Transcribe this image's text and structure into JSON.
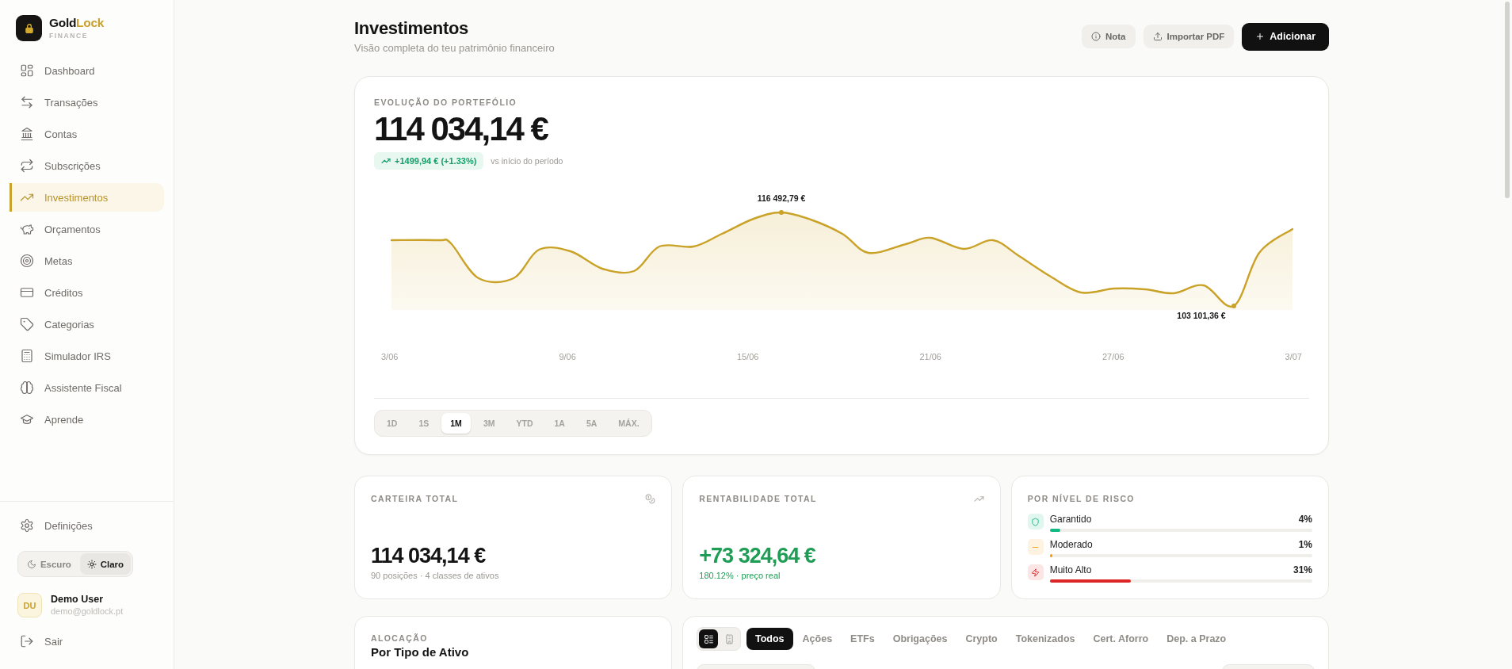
{
  "sidebar": {
    "brand": {
      "name": "Gold",
      "name_accent": "Lock",
      "tagline": "FINANCE"
    },
    "items": [
      {
        "label": "Dashboard",
        "selected": false
      },
      {
        "label": "Transações",
        "selected": false
      },
      {
        "label": "Contas",
        "selected": false
      },
      {
        "label": "Subscrições",
        "selected": false
      },
      {
        "label": "Investimentos",
        "selected": true
      },
      {
        "label": "Orçamentos",
        "selected": false
      },
      {
        "label": "Metas",
        "selected": false
      },
      {
        "label": "Créditos",
        "selected": false
      },
      {
        "label": "Categorias",
        "selected": false
      },
      {
        "label": "Simulador IRS",
        "selected": false
      },
      {
        "label": "Assistente Fiscal",
        "selected": false
      },
      {
        "label": "Aprende",
        "selected": false
      }
    ],
    "settings": {
      "label": "Definições"
    },
    "theme_toggle": [
      {
        "label": "Escuro",
        "selected": false
      },
      {
        "label": "Claro",
        "selected": true
      }
    ],
    "user": {
      "initials": "DU",
      "name": "Demo User",
      "email": "demo@goldlock.pt"
    },
    "logout": {
      "label": "Sair"
    }
  },
  "header": {
    "title": "Investimentos",
    "subtitle": "Visão completa do teu patrimônio financeiro",
    "buttons": [
      {
        "label": "Nota",
        "kind": "ghost"
      },
      {
        "label": "Importar PDF",
        "kind": "ghost"
      },
      {
        "label": "Adicionar",
        "kind": "primary"
      }
    ]
  },
  "portfolio": {
    "label": "EVOLUÇÃO DO PORTEFÓLIO",
    "value": "114 034,14 €",
    "change": "+1499,94 € (+1.33%)",
    "change_note": "vs início do período",
    "peak_label": "116 492,79 €",
    "low_label": "103 101,36 €",
    "x_labels": [
      "3/06",
      "9/06",
      "15/06",
      "21/06",
      "27/06",
      "3/07"
    ],
    "ranges": [
      {
        "label": "1D",
        "selected": false
      },
      {
        "label": "1S",
        "selected": false
      },
      {
        "label": "1M",
        "selected": true
      },
      {
        "label": "3M",
        "selected": false
      },
      {
        "label": "YTD",
        "selected": false
      },
      {
        "label": "1A",
        "selected": false
      },
      {
        "label": "5A",
        "selected": false
      },
      {
        "label": "MÁX.",
        "selected": false
      }
    ]
  },
  "summary_cards": [
    {
      "label": "CARTEIRA TOTAL",
      "value": "114 034,14 €",
      "note": "90 posições · 4 classes de ativos",
      "kind": "neutral"
    },
    {
      "label": "RENTABILIDADE TOTAL",
      "value": "+73 324,64 €",
      "note": "180.12% · preço real",
      "kind": "gain"
    }
  ],
  "risk": {
    "label": "POR NÍVEL DE RISCO",
    "rows": [
      {
        "name": "Garantido",
        "reading": "4%",
        "level": 0.04,
        "color": "#10b981"
      },
      {
        "name": "Moderado",
        "reading": "1%",
        "level": 0.01,
        "color": "#f59e0b"
      },
      {
        "name": "Muito Alto",
        "reading": "31%",
        "level": 0.31,
        "color": "#dc2626"
      }
    ]
  },
  "allocation": {
    "label": "ALOCAÇÃO",
    "title": "Por Tipo de Ativo"
  },
  "holdings": {
    "view_toggle": [
      {
        "selected": true
      },
      {
        "selected": false
      }
    ],
    "tabs": [
      {
        "label": "Todos",
        "selected": true
      },
      {
        "label": "Ações",
        "selected": false
      },
      {
        "label": "ETFs",
        "selected": false
      },
      {
        "label": "Obrigações",
        "selected": false
      },
      {
        "label": "Crypto",
        "selected": false
      },
      {
        "label": "Tokenizados",
        "selected": false
      },
      {
        "label": "Cert. Aforro",
        "selected": false
      },
      {
        "label": "Dep. a Prazo",
        "selected": false
      }
    ]
  }
}
